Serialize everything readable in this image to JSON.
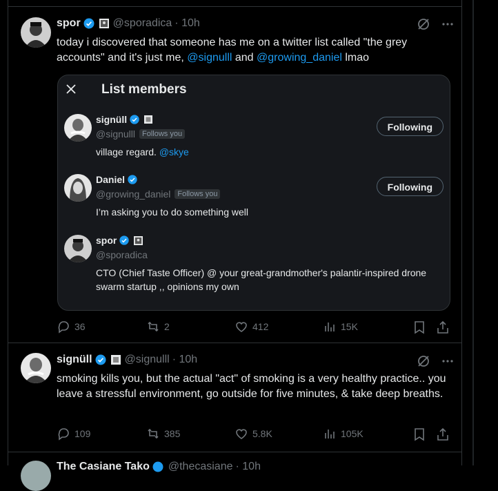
{
  "tweets": [
    {
      "name": "spor",
      "handle": "@sporadica",
      "time": "· 10h",
      "text_before": "today i discovered that someone has me on a twitter list called \"the grey accounts\" and it's just me, ",
      "mention1": "@signulll",
      "text_mid": " and ",
      "mention2": "@growing_daniel",
      "text_after": " lmao",
      "replies": "36",
      "retweets": "2",
      "likes": "412",
      "views": "15K"
    },
    {
      "name": "signüll",
      "handle": "@signulll",
      "time": "· 10h",
      "text": "smoking kills you, but the actual \"act\" of smoking is a very healthy practice.. you leave a stressful environment, go outside for five minutes, & take deep breaths.",
      "replies": "109",
      "retweets": "385",
      "likes": "5.8K",
      "views": "105K"
    }
  ],
  "card": {
    "title": "List members",
    "members": [
      {
        "name": "signüll",
        "handle": "@signulll",
        "follows_you": "Follows you",
        "bio_text": "village regard. ",
        "bio_mention": "@skye",
        "button": "Following"
      },
      {
        "name": "Daniel",
        "handle": "@growing_daniel",
        "follows_you": "Follows you",
        "bio_text": "I’m asking you to do something well",
        "button": "Following"
      },
      {
        "name": "spor",
        "handle": "@sporadica",
        "bio_text": "CTO (Chief Taste Officer) @ your great-grandmother's palantir-inspired drone swarm startup ,, opinions my own"
      }
    ]
  },
  "next_tweet_partial": {
    "name": "The Casiane Tako",
    "handle": "@thecasiane",
    "time": "· 10h"
  },
  "colors": {
    "accent": "#1d9bf0",
    "muted": "#71767b",
    "background": "#000000",
    "border": "#2f3336"
  }
}
